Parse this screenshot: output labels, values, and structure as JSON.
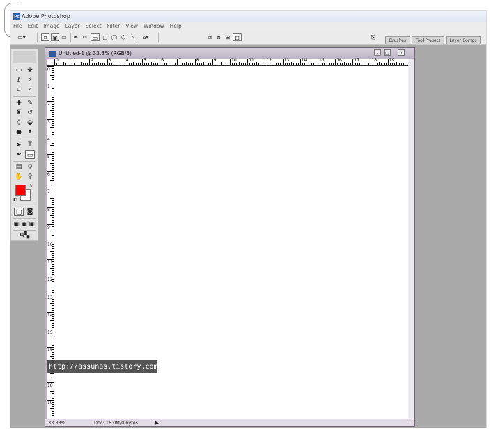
{
  "app": {
    "title": "Adobe Photoshop",
    "icon": "photoshop-icon"
  },
  "menu": [
    "File",
    "Edit",
    "Image",
    "Layer",
    "Select",
    "Filter",
    "View",
    "Window",
    "Help"
  ],
  "palette_tabs": [
    "Brushes",
    "Tool Presets",
    "Layer Comps"
  ],
  "document": {
    "title": "Untitled-1 @ 33.3% (RGB/8)",
    "zoom": "33.33%",
    "doc_info": "Doc: 16.0M/0 bytes"
  },
  "ruler": {
    "top_labels": [
      "0",
      "1",
      "2",
      "3",
      "4",
      "5",
      "6",
      "7",
      "8",
      "9",
      "10",
      "11",
      "12",
      "13",
      "14",
      "15",
      "16",
      "17",
      "18",
      "19"
    ],
    "left_labels": [
      "0",
      "1",
      "2",
      "3",
      "4",
      "5",
      "6",
      "7",
      "8",
      "9",
      "10",
      "11",
      "12",
      "13",
      "14",
      "15",
      "16",
      "17",
      "18",
      "19"
    ]
  },
  "colors": {
    "foreground": "#ff0000",
    "background": "#ffffff"
  },
  "watermark": "http://assunas.tistory.com"
}
